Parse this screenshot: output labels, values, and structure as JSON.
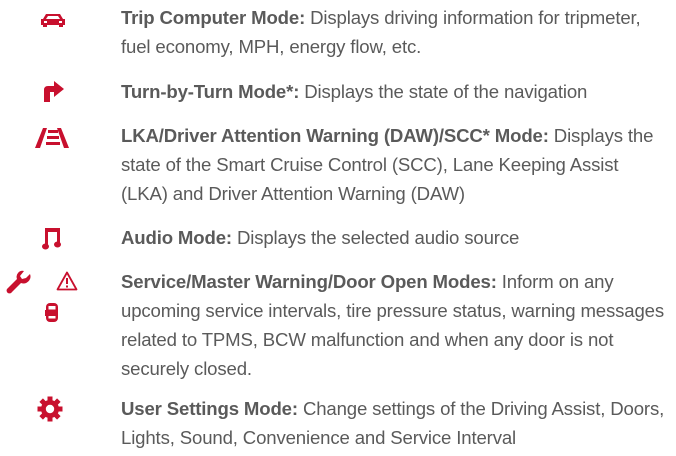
{
  "colors": {
    "accent": "#c8102e",
    "text": "#5a5a5a",
    "background": "#ffffff"
  },
  "items": [
    {
      "icon": "car-icon",
      "title": "Trip Computer Mode:",
      "desc": " Displays driving information for tripmeter, fuel economy, MPH, energy flow, etc."
    },
    {
      "icon": "turn-arrow-icon",
      "title": "Turn-by-Turn Mode*:",
      "desc": " Displays the state of the navigation"
    },
    {
      "icon": "lane-keeping-icon",
      "title": "LKA/Driver Attention Warning (DAW)/SCC* Mode:",
      "desc": " Displays the state of the Smart Cruise Control (SCC), Lane Keeping Assist (LKA) and Driver Attention Warning (DAW)"
    },
    {
      "icon": "music-note-icon",
      "title": "Audio Mode:",
      "desc": " Displays the selected audio source"
    },
    {
      "icon": "wrench-icon, warning-triangle-icon, door-open-icon",
      "title": "Service/Master Warning/Door Open Modes:",
      "desc": " Inform on any upcoming service intervals, tire pressure status, warning messages related to TPMS, BCW malfunction and when any door is not securely closed."
    },
    {
      "icon": "gear-icon",
      "title": "User Settings Mode:",
      "desc": " Change settings of the Driving Assist, Doors, Lights, Sound, Convenience and Service Interval"
    }
  ]
}
